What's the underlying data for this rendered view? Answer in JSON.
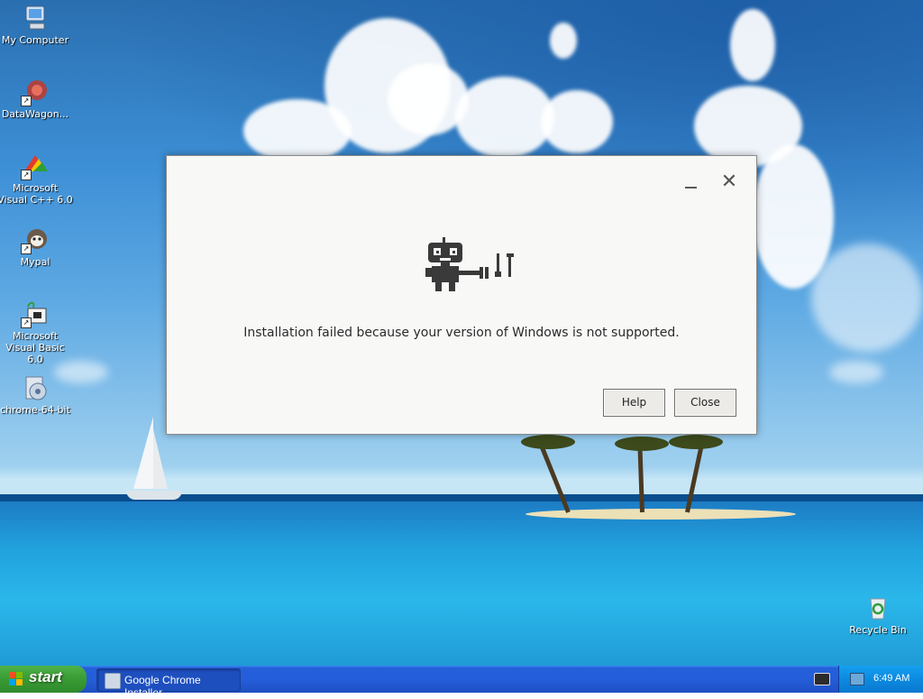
{
  "desktop": {
    "icons": [
      {
        "label": "My Computer",
        "icon": "my-computer-icon"
      },
      {
        "label": "DataWagon...",
        "icon": "datawagon-icon"
      },
      {
        "label": "Microsoft Visual C++ 6.0",
        "icon": "visual-cpp-icon"
      },
      {
        "label": "Mypal",
        "icon": "mypal-icon"
      },
      {
        "label": "Microsoft Visual Basic 6.0",
        "icon": "visual-basic-icon"
      },
      {
        "label": "chrome-64-bit",
        "icon": "installer-icon"
      },
      {
        "label": "Recycle Bin",
        "icon": "recycle-bin-icon"
      }
    ]
  },
  "dialog": {
    "message": "Installation failed because your version of Windows is not supported.",
    "help_label": "Help",
    "close_label": "Close",
    "close_glyph": "✕",
    "illustration": "robot-with-tools-icon"
  },
  "taskbar": {
    "start_label": "start",
    "task_label": "Google Chrome Installer",
    "clock": "6:49 AM"
  },
  "colors": {
    "taskbar_blue": "#245edb",
    "start_green": "#3a9d35",
    "dialog_bg": "#f8f8f7"
  }
}
